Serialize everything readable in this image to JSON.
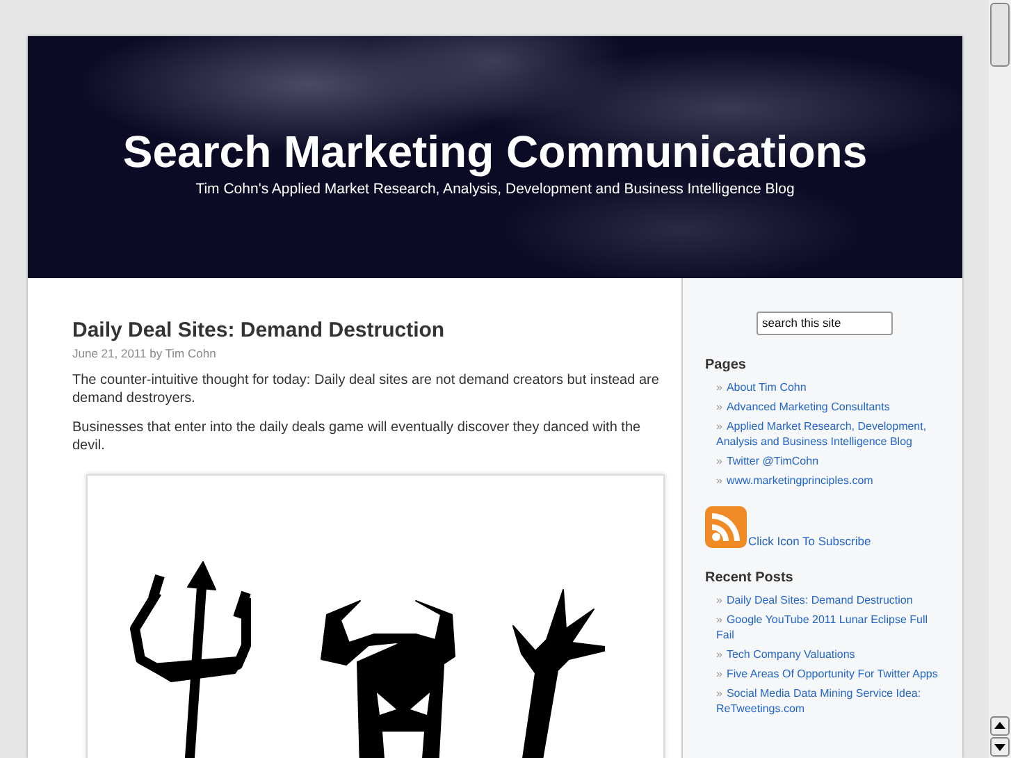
{
  "header": {
    "title": "Search Marketing Communications",
    "tagline": "Tim Cohn's Applied Market Research, Analysis, Development and Business Intelligence Blog"
  },
  "post": {
    "title": "Daily Deal Sites: Demand Destruction",
    "meta": "June 21, 2011 by Tim Cohn",
    "paragraphs": [
      "The counter-intuitive thought for today: Daily deal sites are not demand creators but instead are demand destroyers.",
      "Businesses that enter into the daily deals game will eventually discover they danced with the devil."
    ]
  },
  "sidebar": {
    "search": {
      "value": "search this site"
    },
    "pages": {
      "heading": "Pages",
      "items": [
        {
          "bullet": "»",
          "label": "About Tim Cohn"
        },
        {
          "bullet": "»",
          "label": "Advanced Marketing Consultants"
        },
        {
          "bullet": "»",
          "label": "Applied Market Research, Development, Analysis and Business Intelligence Blog"
        },
        {
          "bullet": "»",
          "label": "Twitter @TimCohn"
        },
        {
          "bullet": "»",
          "label": "www.marketingprinciples.com"
        }
      ]
    },
    "subscribe": {
      "label": "Click Icon To Subscribe"
    },
    "recent": {
      "heading": "Recent Posts",
      "items": [
        {
          "bullet": "»",
          "label": "Daily Deal Sites: Demand Destruction"
        },
        {
          "bullet": "»",
          "label": "Google YouTube 2011 Lunar Eclipse Full Fail"
        },
        {
          "bullet": "»",
          "label": "Tech Company Valuations"
        },
        {
          "bullet": "»",
          "label": "Five Areas Of Opportunity For Twitter Apps"
        },
        {
          "bullet": "»",
          "label": "Social Media Data Mining Service Idea: ReTweetings.com"
        }
      ]
    }
  }
}
